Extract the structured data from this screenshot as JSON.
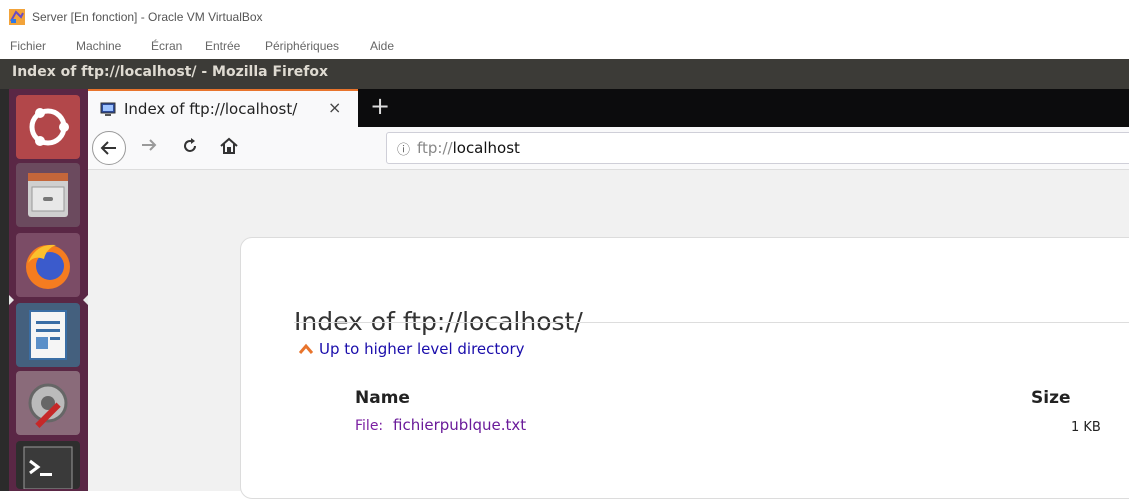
{
  "vbox": {
    "title": "Server [En fonction] - Oracle VM VirtualBox",
    "menu": [
      "Fichier",
      "Machine",
      "Écran",
      "Entrée",
      "Périphériques",
      "Aide"
    ]
  },
  "guest": {
    "window_title": "Index of ftp://localhost/ - Mozilla Firefox",
    "launcher": [
      {
        "name": "ubuntu-dash-icon"
      },
      {
        "name": "file-cabinet-icon"
      },
      {
        "name": "firefox-icon",
        "active": true
      },
      {
        "name": "writer-document-icon"
      },
      {
        "name": "system-settings-icon"
      },
      {
        "name": "terminal-icon"
      }
    ]
  },
  "firefox": {
    "tab": {
      "title": "Index of ftp://localhost/",
      "close": "×"
    },
    "new_tab": "+",
    "url": {
      "scheme": "ftp://",
      "host": "localhost"
    },
    "page": {
      "heading": "Index of ftp://localhost/",
      "up_link": "Up to higher level directory",
      "columns": {
        "name": "Name",
        "size": "Size"
      },
      "files": [
        {
          "prefix": "File:",
          "name": "fichierpublque.txt",
          "size": "1 KB"
        }
      ]
    }
  },
  "colors": {
    "launcher_bg": "#5a2745",
    "top_bar": "#3c3b37",
    "tab_accent": "#e8742c",
    "link": "#1a0dab",
    "visited": "#6a1b9a"
  }
}
